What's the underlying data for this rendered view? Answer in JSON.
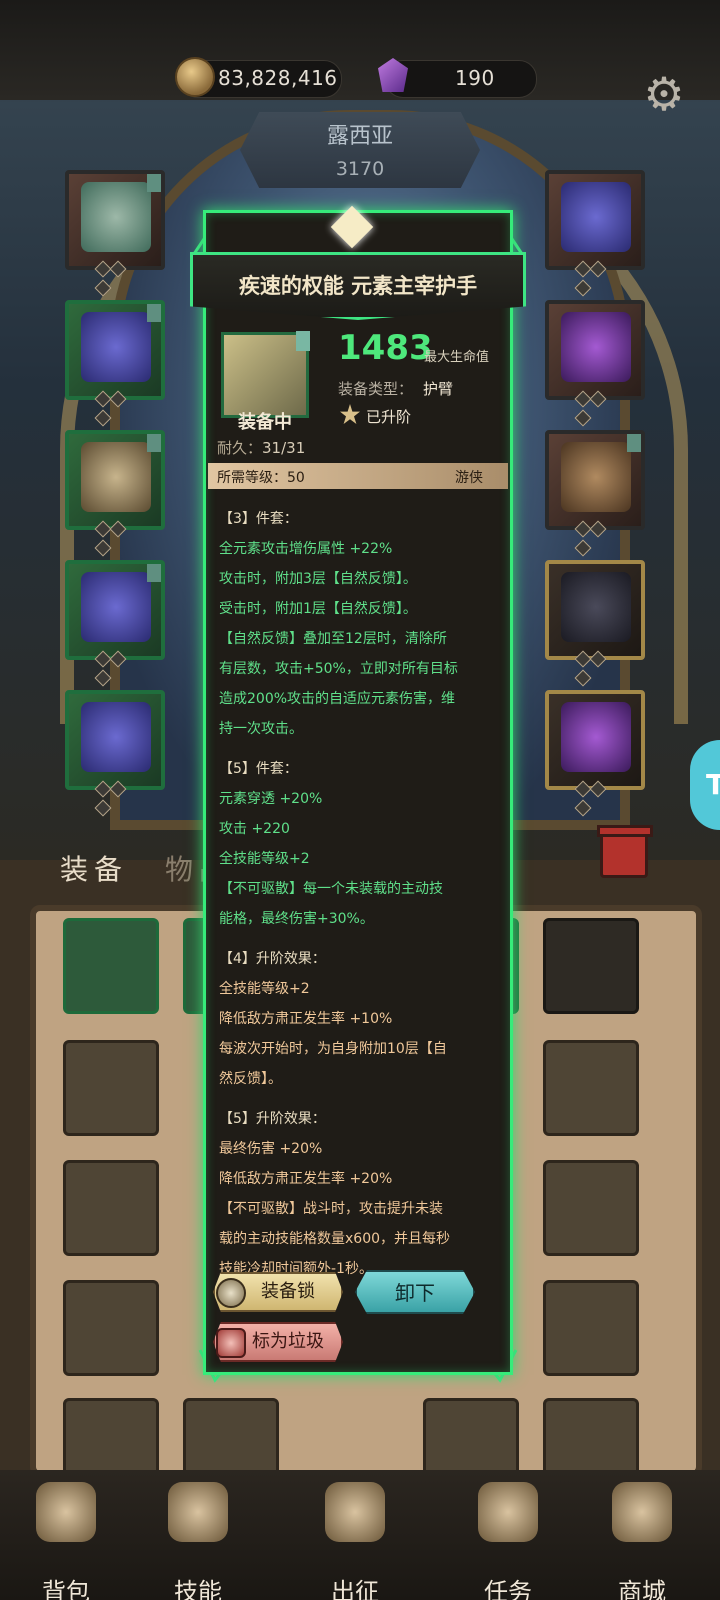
{
  "currency": {
    "gold": "83,828,416",
    "gems": "190"
  },
  "character": {
    "name": "露西亚",
    "power": "3170"
  },
  "tabs": {
    "equipment": "装备",
    "items": "物品"
  },
  "tooltip": {
    "title": "疾速的权能 元素主宰护手",
    "equipped": "装备中",
    "stat_value": "1483",
    "stat_label": "最大生命值",
    "type_label": "装备类型：",
    "type_value": "护臂",
    "upgraded": "已升阶",
    "durability_label": "耐久：",
    "durability_value": "31/31",
    "required_level": "所需等级：50",
    "class": "游侠",
    "lines": [
      {
        "text": "【3】件套：",
        "style": "head"
      },
      {
        "text": "全元素攻击增伤属性 +22%",
        "style": "green"
      },
      {
        "text": "攻击时，附加3层【自然反馈】。",
        "style": "green"
      },
      {
        "text": "受击时，附加1层【自然反馈】。",
        "style": "green"
      },
      {
        "text": "【自然反馈】叠加至12层时，清除所",
        "style": "green"
      },
      {
        "text": "有层数，攻击+50%，立即对所有目标",
        "style": "green"
      },
      {
        "text": "造成200%攻击的自适应元素伤害，维",
        "style": "green"
      },
      {
        "text": "持一次攻击。",
        "style": "green"
      },
      {
        "text": "【5】件套：",
        "style": "head"
      },
      {
        "text": "元素穿透 +20%",
        "style": "green"
      },
      {
        "text": "攻击 +220",
        "style": "green"
      },
      {
        "text": "全技能等级+2",
        "style": "green"
      },
      {
        "text": "【不可驱散】每一个未装载的主动技",
        "style": "green"
      },
      {
        "text": "能格，最终伤害+30%。",
        "style": "green"
      },
      {
        "text": "【4】升阶效果：",
        "style": "head"
      },
      {
        "text": "全技能等级+2",
        "style": "orange"
      },
      {
        "text": "降低敌方肃正发生率 +10%",
        "style": "orange"
      },
      {
        "text": "每波次开始时，为自身附加10层【自",
        "style": "orange"
      },
      {
        "text": "然反馈】。",
        "style": "orange"
      },
      {
        "text": "【5】升阶效果：",
        "style": "head"
      },
      {
        "text": "最终伤害 +20%",
        "style": "orange"
      },
      {
        "text": "降低敌方肃正发生率 +20%",
        "style": "orange"
      },
      {
        "text": "【不可驱散】战斗时，攻击提升未装",
        "style": "orange"
      },
      {
        "text": "载的主动技能格数量x600，并且每秒",
        "style": "orange"
      },
      {
        "text": "技能冷却时间额外-1秒。",
        "style": "orange"
      }
    ],
    "lock_button": "装备锁",
    "unequip_button": "卸下",
    "mark_trash_button": "标为垃圾"
  },
  "side_bubble": "To",
  "nav": [
    {
      "label": "背包",
      "icon": "backpack-icon"
    },
    {
      "label": "技能",
      "icon": "skill-book-icon"
    },
    {
      "label": "出征",
      "icon": "sword-map-icon"
    },
    {
      "label": "任务",
      "icon": "scroll-icon"
    },
    {
      "label": "商城",
      "icon": "shop-icon"
    }
  ],
  "colors": {
    "tooltip_border": "#36ec7a",
    "set_text": "#5fe08a",
    "upgrade_text": "#f0c89a",
    "stat_value": "#4ee87c"
  }
}
